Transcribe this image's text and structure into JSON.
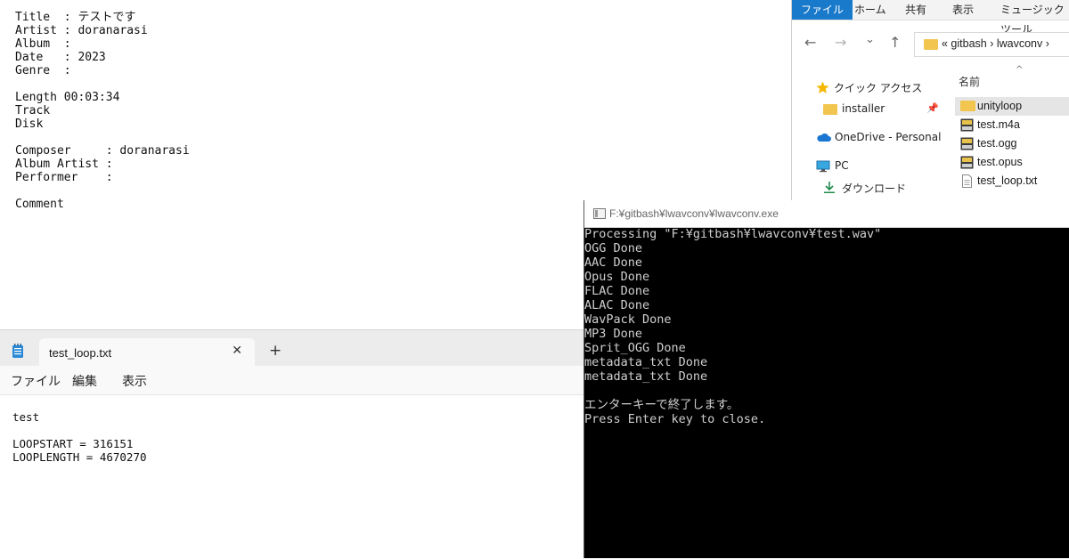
{
  "metadata_window": {
    "lines": [
      "Title  : テストです",
      "Artist : doranarasi",
      "Album  :",
      "Date   : 2023",
      "Genre  :",
      "",
      "Length 00:03:34",
      "Track",
      "Disk",
      "",
      "Composer     : doranarasi",
      "Album Artist :",
      "Performer    :",
      "",
      "Comment"
    ]
  },
  "notepad": {
    "app_icon": "notepad-icon",
    "tab_title": "test_loop.txt",
    "tab_close": "✕",
    "new_tab": "+",
    "menu": [
      "ファイル",
      "編集",
      "表示"
    ],
    "content": [
      "test",
      "",
      "LOOPSTART = 316151",
      "LOOPLENGTH = 4670270"
    ]
  },
  "explorer": {
    "ribbon_tabs": [
      "ファイル",
      "ホーム",
      "共有",
      "表示",
      "ミュージック ツール"
    ],
    "nav_icons": {
      "back": "←",
      "forward": "→",
      "recent": "⌄",
      "up": "↑"
    },
    "address": "« gitbash › lwavconv ›",
    "column_header": "名前",
    "sort_indicator": "^",
    "nav_pane": [
      {
        "label": "クイック アクセス",
        "icon": "star-icon"
      },
      {
        "label": "installer",
        "icon": "folder-icon",
        "pin": "pin-icon"
      },
      {
        "label": "OneDrive - Personal",
        "icon": "cloud-icon"
      },
      {
        "label": "PC",
        "icon": "monitor-icon"
      },
      {
        "label": "ダウンロード",
        "icon": "download-icon"
      }
    ],
    "files": [
      {
        "name": "unityloop",
        "icon": "folder-icon",
        "selected": true
      },
      {
        "name": "test.m4a",
        "icon": "audio-file-icon"
      },
      {
        "name": "test.ogg",
        "icon": "audio-file-icon"
      },
      {
        "name": "test.opus",
        "icon": "audio-file-icon"
      },
      {
        "name": "test_loop.txt",
        "icon": "text-file-icon"
      }
    ]
  },
  "console": {
    "title": "F:¥gitbash¥lwavconv¥lwavconv.exe",
    "lines": [
      "Processing \"F:¥gitbash¥lwavconv¥test.wav\"",
      "OGG Done",
      "AAC Done",
      "Opus Done",
      "FLAC Done",
      "ALAC Done",
      "WavPack Done",
      "MP3 Done",
      "Sprit_OGG Done",
      "metadata_txt Done",
      "metadata_txt Done",
      "",
      "エンターキーで終了します。",
      "Press Enter key to close."
    ]
  },
  "colors": {
    "ribbon_active": "#1979ca",
    "folder": "#f2c54e",
    "console_bg": "#000000",
    "console_text": "#cfcfcf"
  }
}
